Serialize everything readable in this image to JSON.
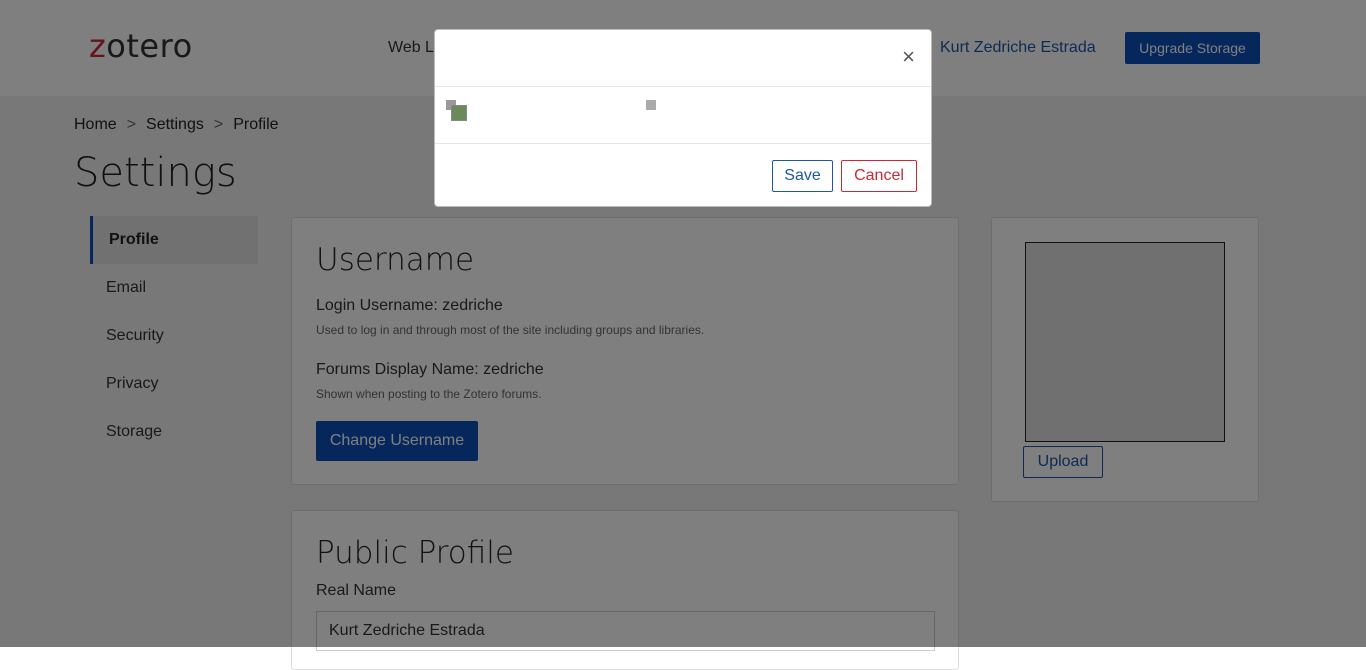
{
  "header": {
    "logo_z": "z",
    "logo_rest": "otero",
    "nav_partial": "Web L",
    "user_name": "Kurt Zedriche Estrada",
    "upgrade_label": "Upgrade Storage"
  },
  "breadcrumb": {
    "items": [
      "Home",
      "Settings",
      "Profile"
    ],
    "separator": ">"
  },
  "page_title": "Settings",
  "sidebar": {
    "items": [
      {
        "label": "Profile",
        "active": true
      },
      {
        "label": "Email"
      },
      {
        "label": "Security"
      },
      {
        "label": "Privacy"
      },
      {
        "label": "Storage"
      }
    ]
  },
  "username_card": {
    "title": "Username",
    "login_label": "Login Username: zedriche",
    "login_help": "Used to log in and through most of the site including groups and libraries.",
    "forums_label": "Forums Display Name: zedriche",
    "forums_help": "Shown when posting to the Zotero forums.",
    "change_button": "Change Username"
  },
  "avatar_card": {
    "upload_label": "Upload"
  },
  "public_profile": {
    "title": "Public Profile",
    "real_name_label": "Real Name",
    "real_name_value": "Kurt Zedriche Estrada"
  },
  "modal": {
    "close_glyph": "×",
    "save_label": "Save",
    "cancel_label": "Cancel"
  },
  "colors": {
    "brand_blue": "#0b4fb8",
    "brand_red": "#cc2936",
    "overlay": "rgba(0,0,0,0.5)"
  }
}
